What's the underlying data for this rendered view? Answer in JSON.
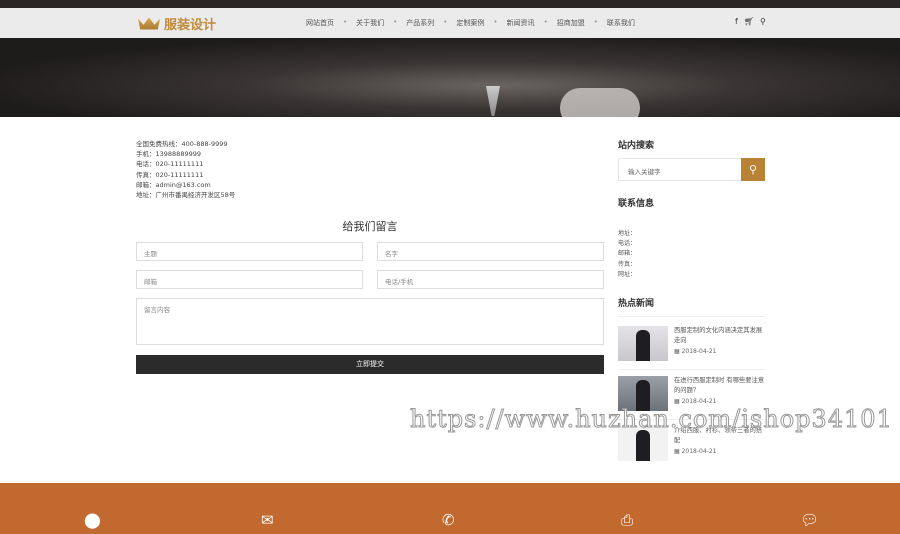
{
  "header": {
    "logo": "服装设计",
    "menu": [
      "网站首页",
      "关于我们",
      "产品系列",
      "定制案例",
      "新闻资讯",
      "招商加盟",
      "联系我们"
    ],
    "separator": "•",
    "icons": [
      "facebook-icon",
      "cart-icon",
      "search-icon"
    ]
  },
  "contact": [
    "全国免费热线：400-888-9999",
    "手机：13988889999",
    "电话：020-11111111",
    "传真：020-11111111",
    "邮箱：admin@163.com",
    "地址：广州市番禺经济开发区58号"
  ],
  "form": {
    "title": "给我们留言",
    "subject": "主题",
    "name": "名字",
    "email": "邮箱",
    "phone": "电话/手机",
    "message": "留言内容",
    "submit": "立即提交"
  },
  "sidebar": {
    "search_title": "站内搜索",
    "search_placeholder": "输入关键字",
    "contact_title": "联系信息",
    "contact_fields": [
      "地址：",
      "电话：",
      "邮箱：",
      "传真：",
      "网址："
    ],
    "news_title": "热点新闻",
    "news": [
      {
        "title": "西服定制的文化内涵决定其发展走向",
        "date": "2018-04-21"
      },
      {
        "title": "在进行西服定制时 有哪些要注意的问题？",
        "date": "2018-04-21"
      },
      {
        "title": "介绍西服、衬衫、领带三者的搭配",
        "date": "2018-04-21"
      }
    ]
  },
  "footer_icons": [
    "location-icon",
    "mail-icon",
    "phone-icon",
    "printer-icon",
    "wechat-icon"
  ],
  "watermark": "https://www.huzhan.com/ishop34101"
}
